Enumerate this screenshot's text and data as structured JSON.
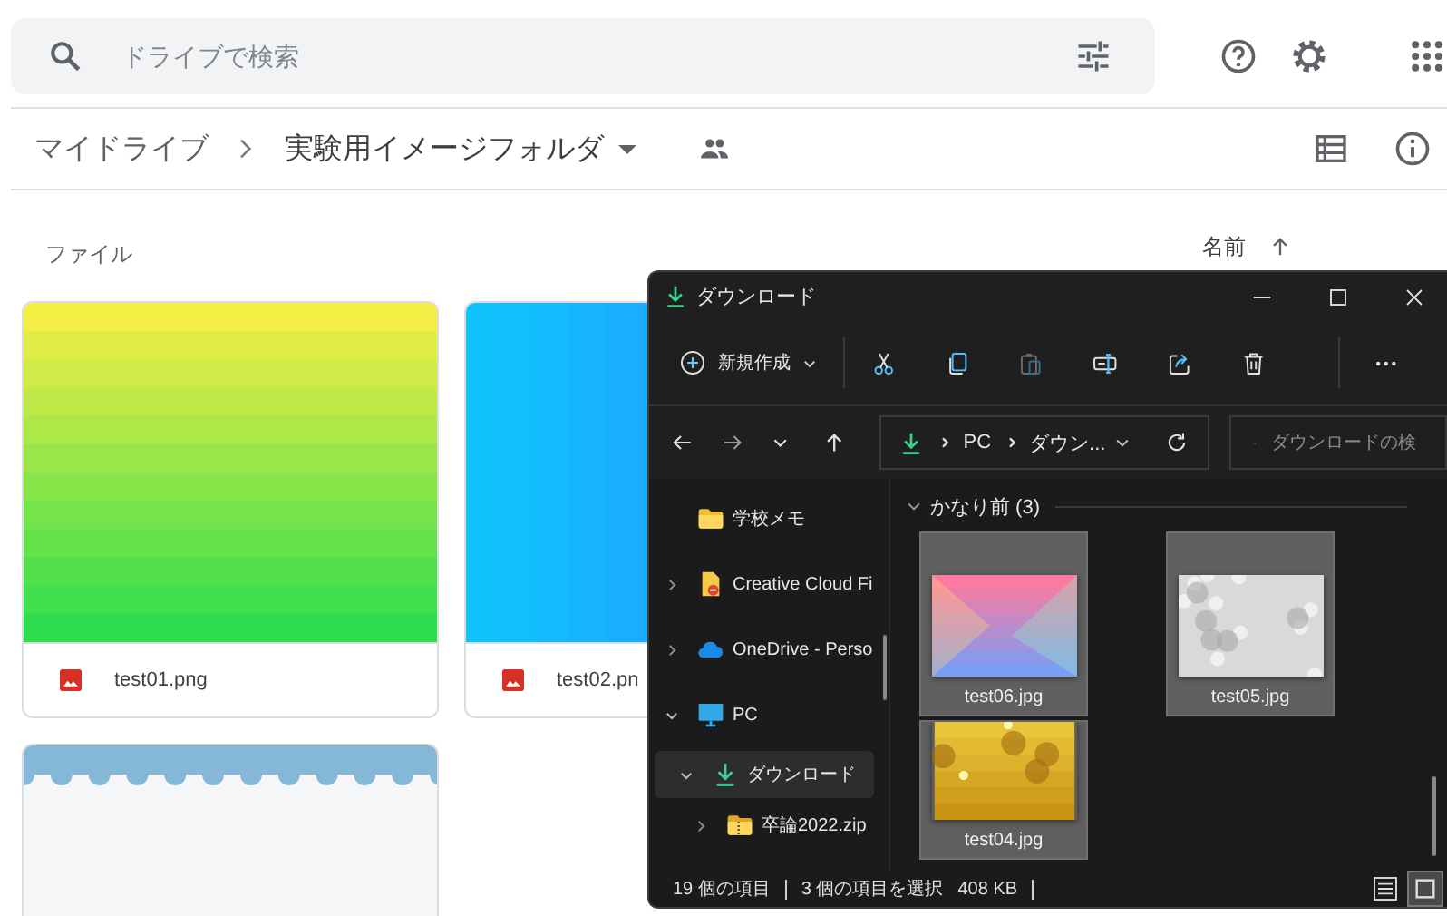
{
  "search": {
    "placeholder": "ドライブで検索"
  },
  "breadcrumb": [
    {
      "label": "マイドライブ"
    },
    {
      "label": "実験用イメージフォルダ"
    }
  ],
  "section_title": "ファイル",
  "sort": {
    "label": "名前"
  },
  "files": [
    {
      "name": "test01.png",
      "kind": "picture"
    },
    {
      "name": "test02.pn",
      "kind": "picture"
    },
    {
      "kind": "picture"
    }
  ],
  "explorer": {
    "title": "ダウンロード",
    "new_button": "新規作成",
    "address": [
      "PC",
      "ダウン..."
    ],
    "search": {
      "placeholder": "ダウンロードの検"
    },
    "nav": [
      {
        "label": "学校メモ",
        "kind": "folder",
        "expandable": false,
        "selected": false
      },
      {
        "label": "Creative Cloud Fi",
        "kind": "creative-cloud",
        "expandable": true,
        "expanded": false,
        "selected": false
      },
      {
        "label": "OneDrive - Perso",
        "kind": "cloud",
        "expandable": true,
        "expanded": false,
        "selected": false
      },
      {
        "label": "PC",
        "kind": "pc",
        "expandable": true,
        "expanded": true,
        "selected": false,
        "children": [
          {
            "label": "ダウンロード",
            "kind": "download",
            "expandable": true,
            "expanded": true,
            "selected": true,
            "children": [
              {
                "label": "卒論2022.zip",
                "kind": "zip",
                "expandable": true,
                "expanded": false,
                "selected": false
              }
            ]
          }
        ]
      }
    ],
    "group": {
      "label": "かなり前 (3)",
      "expanded": true
    },
    "items": [
      {
        "name": "test06.jpg",
        "kind": "picture",
        "selected": true
      },
      {
        "name": "test05.jpg",
        "kind": "picture",
        "selected": true
      },
      {
        "name": "test04.jpg",
        "kind": "picture",
        "selected": true
      }
    ],
    "status": {
      "count": "19 個の項目",
      "selection": "3 個の項目を選択",
      "size": "408 KB"
    },
    "views": [
      {
        "kind": "details",
        "selected": false
      },
      {
        "kind": "large-icons",
        "selected": true
      }
    ]
  }
}
